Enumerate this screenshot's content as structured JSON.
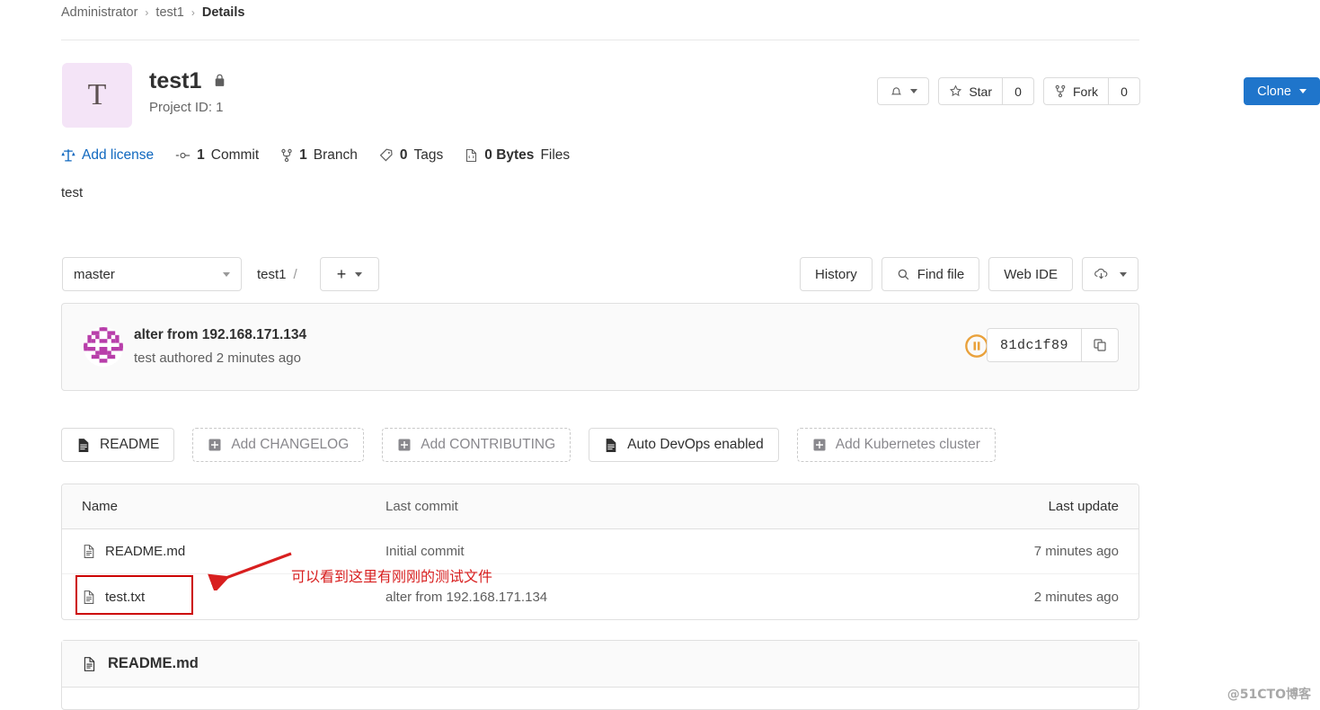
{
  "breadcrumb": {
    "owner": "Administrator",
    "project": "test1",
    "current": "Details",
    "separator": "›"
  },
  "project": {
    "avatar_letter": "T",
    "avatar_bg": "#f4e4f7",
    "name": "test1",
    "visibility_icon": "lock-icon",
    "project_id_label": "Project ID: 1",
    "description": "test"
  },
  "header_actions": {
    "notification_icon": "bell-icon",
    "star_label": "Star",
    "star_count": "0",
    "fork_label": "Fork",
    "fork_count": "0",
    "clone_label": "Clone",
    "clone_color": "#1f75cb"
  },
  "stats": [
    {
      "icon": "scale-icon",
      "label": "Add license",
      "is_link": true,
      "link_color": "#1068bf"
    },
    {
      "icon": "commit-icon",
      "count": "1",
      "label": "Commit"
    },
    {
      "icon": "branch-icon",
      "count": "1",
      "label": "Branch"
    },
    {
      "icon": "tag-icon",
      "count": "0",
      "label": "Tags"
    },
    {
      "icon": "file-icon",
      "count": "0 Bytes",
      "label": "Files"
    }
  ],
  "toolbar": {
    "branch": "master",
    "path_project": "test1",
    "path_slash": "/",
    "add_plus": "+",
    "history_label": "History",
    "find_file_label": "Find file",
    "find_file_icon": "search-icon",
    "web_ide_label": "Web IDE",
    "download_icon": "download-cloud-icon"
  },
  "commit": {
    "message": "alter from 192.168.171.134",
    "meta": "test authored 2 minutes ago",
    "pipeline_status_icon": "pipeline-paused-icon",
    "pipeline_status_color": "#e9a13b",
    "sha": "81dc1f89",
    "copy_icon": "copy-icon"
  },
  "file_actions": [
    {
      "label": "README",
      "icon": "doc-icon",
      "style": "solid"
    },
    {
      "label": "Add CHANGELOG",
      "icon": "plus-box-icon",
      "style": "dashed"
    },
    {
      "label": "Add CONTRIBUTING",
      "icon": "plus-box-icon",
      "style": "dashed"
    },
    {
      "label": "Auto DevOps enabled",
      "icon": "doc-icon",
      "style": "solid"
    },
    {
      "label": "Add Kubernetes cluster",
      "icon": "plus-box-icon",
      "style": "dashed"
    }
  ],
  "file_tree": {
    "headers": {
      "name": "Name",
      "last_commit": "Last commit",
      "last_update": "Last update"
    },
    "rows": [
      {
        "icon": "file-doc-icon",
        "name": "README.md",
        "last_commit": "Initial commit",
        "last_update": "7 minutes ago"
      },
      {
        "icon": "file-doc-icon",
        "name": "test.txt",
        "last_commit": "alter from 192.168.171.134",
        "last_update": "2 minutes ago"
      }
    ]
  },
  "readme": {
    "icon": "file-doc-icon",
    "title": "README.md"
  },
  "annotation": {
    "text": "可以看到这里有刚刚的测试文件",
    "color": "#d81f1f"
  },
  "watermark": "@51CTO博客"
}
